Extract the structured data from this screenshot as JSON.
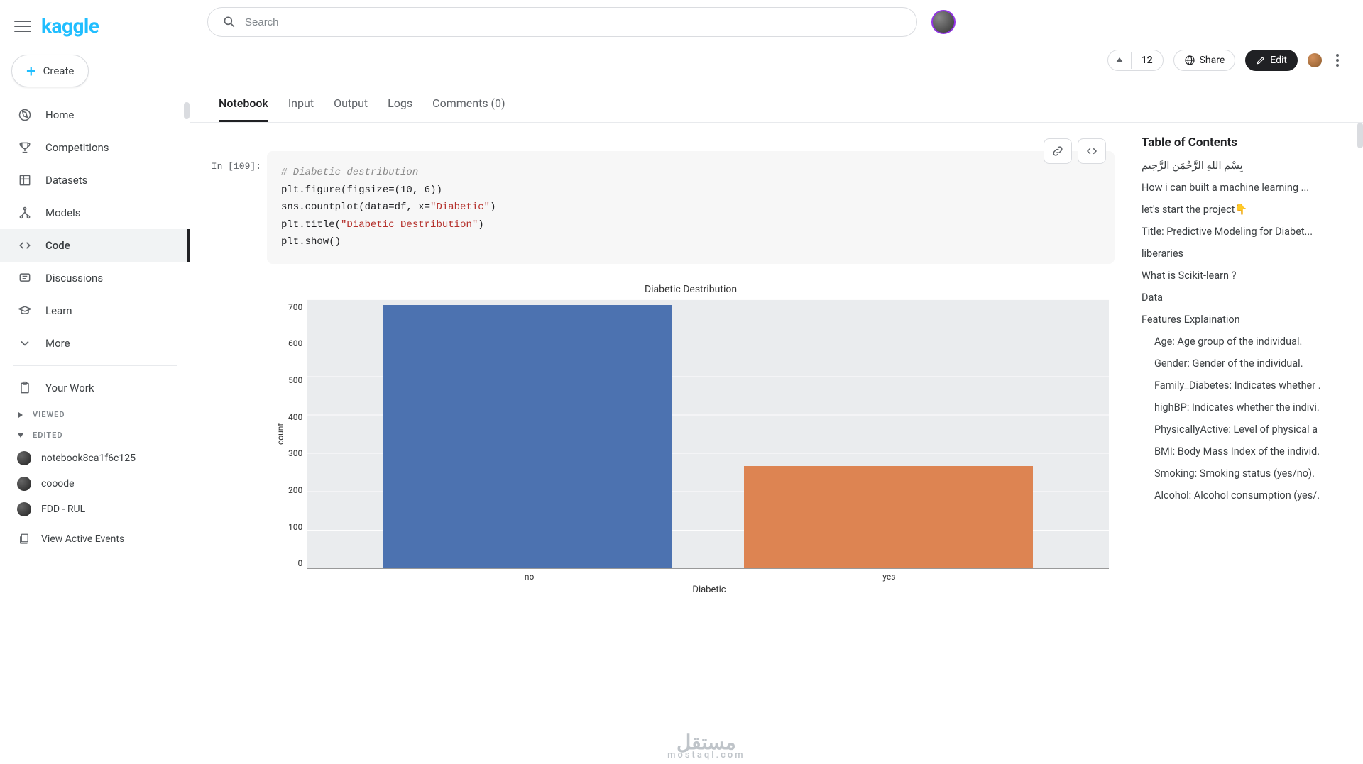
{
  "brand": {
    "logo": "kaggle"
  },
  "sidebar": {
    "create": "Create",
    "nav": [
      {
        "label": "Home",
        "active": false
      },
      {
        "label": "Competitions",
        "active": false
      },
      {
        "label": "Datasets",
        "active": false
      },
      {
        "label": "Models",
        "active": false
      },
      {
        "label": "Code",
        "active": true
      },
      {
        "label": "Discussions",
        "active": false
      },
      {
        "label": "Learn",
        "active": false
      },
      {
        "label": "More",
        "active": false
      }
    ],
    "your_work": "Your Work",
    "viewed_label": "VIEWED",
    "edited_label": "EDITED",
    "recent": [
      {
        "label": "notebook8ca1f6c125"
      },
      {
        "label": "cooode"
      },
      {
        "label": "FDD - RUL"
      }
    ],
    "view_active_events": "View Active Events"
  },
  "search": {
    "placeholder": "Search"
  },
  "actions": {
    "vote_count": "12",
    "share": "Share",
    "edit": "Edit"
  },
  "tabs": [
    {
      "label": "Notebook",
      "active": true
    },
    {
      "label": "Input",
      "active": false
    },
    {
      "label": "Output",
      "active": false
    },
    {
      "label": "Logs",
      "active": false
    },
    {
      "label": "Comments (0)",
      "active": false
    }
  ],
  "cell": {
    "prompt": "In [109]:",
    "code_lines": {
      "l1": "# Diabetic destribution",
      "l2a": "plt.figure(figsize=(",
      "l2b": "10",
      "l2c": ", ",
      "l2d": "6",
      "l2e": "))",
      "l3a": "sns.countplot(data=df, x=",
      "l3b": "\"Diabetic\"",
      "l3c": ")",
      "l4a": "plt.title(",
      "l4b": "\"Diabetic Destribution\"",
      "l4c": ")",
      "l5": "plt.show()"
    }
  },
  "chart_data": {
    "type": "bar",
    "title": "Diabetic Destribution",
    "xlabel": "Diabetic",
    "ylabel": "count",
    "categories": [
      "no",
      "yes"
    ],
    "values": [
      685,
      265
    ],
    "ylim": [
      0,
      700
    ],
    "yticks": [
      "0",
      "100",
      "200",
      "300",
      "400",
      "500",
      "600",
      "700"
    ],
    "colors": [
      "#4c72b0",
      "#dd8452"
    ]
  },
  "toc": {
    "title": "Table of Contents",
    "items": [
      {
        "label": "بِسْمِ اللهِ الرَّحْمَنِ الرَّحِيمِ",
        "sub": false
      },
      {
        "label": "How i can built a machine learning ...",
        "sub": false
      },
      {
        "label": "let's start the project👇",
        "sub": false
      },
      {
        "label": "Title: Predictive Modeling for Diabet...",
        "sub": false
      },
      {
        "label": "liberaries",
        "sub": false
      },
      {
        "label": "What is Scikit-learn ?",
        "sub": false
      },
      {
        "label": "Data",
        "sub": false
      },
      {
        "label": "Features Explaination",
        "sub": false
      },
      {
        "label": "Age: Age group of the individual.",
        "sub": true
      },
      {
        "label": "Gender: Gender of the individual.",
        "sub": true
      },
      {
        "label": "Family_Diabetes: Indicates whether .",
        "sub": true
      },
      {
        "label": "highBP: Indicates whether the indivi.",
        "sub": true
      },
      {
        "label": "PhysicallyActive: Level of physical a",
        "sub": true
      },
      {
        "label": "BMI: Body Mass Index of the individ.",
        "sub": true
      },
      {
        "label": "Smoking: Smoking status (yes/no).",
        "sub": true
      },
      {
        "label": "Alcohol: Alcohol consumption (yes/.",
        "sub": true
      }
    ]
  },
  "watermark": {
    "main": "مستقل",
    "sub": "mostaql.com"
  }
}
